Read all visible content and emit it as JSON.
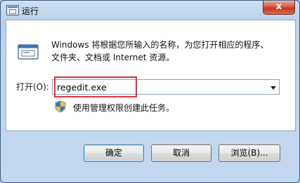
{
  "window": {
    "title": "运行",
    "close_glyph": "x"
  },
  "description": {
    "line1": "Windows 将根据您所输入的名称，为您打开相应的程序、",
    "line2": "文件夹、文档或 Internet 资源。"
  },
  "open_field": {
    "label": "打开(O):",
    "value": "regedit.exe"
  },
  "admin_note": "使用管理权限创建此任务。",
  "buttons": {
    "ok": "确定",
    "cancel": "取消",
    "browse": "浏览(B)..."
  },
  "colors": {
    "highlight": "#d9343f",
    "close_button": "#c0391f"
  },
  "icons": [
    "run-dialog-icon",
    "run-program-icon",
    "uac-shield-icon",
    "dropdown-arrow-icon"
  ]
}
